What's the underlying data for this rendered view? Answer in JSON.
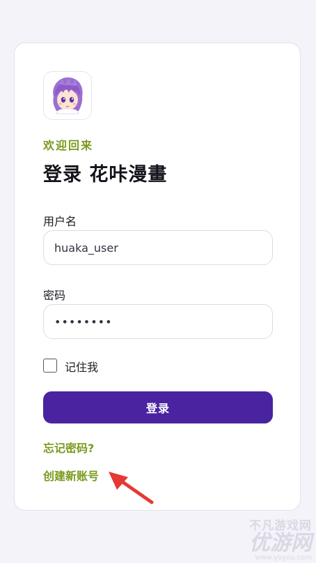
{
  "welcome_text": "欢迎回来",
  "title": "登录 花咔漫畫",
  "username": {
    "label": "用户名",
    "value": "huaka_user"
  },
  "password": {
    "label": "密码",
    "value": "••••••••"
  },
  "remember": {
    "label": "记住我",
    "checked": false
  },
  "login_button_label": "登录",
  "forgot_link": "忘记密码?",
  "create_account_link": "创建新账号",
  "watermark": {
    "top": "不凡游戏网",
    "main": "优游网",
    "url": "www.yoyou.com"
  },
  "colors": {
    "accent_green": "#7a9a1d",
    "primary_purple": "#4a24a0",
    "annotation_red": "#e53935"
  },
  "icons": {
    "logo": "anime-avatar-logo",
    "annotation": "red-pointer-arrow"
  }
}
